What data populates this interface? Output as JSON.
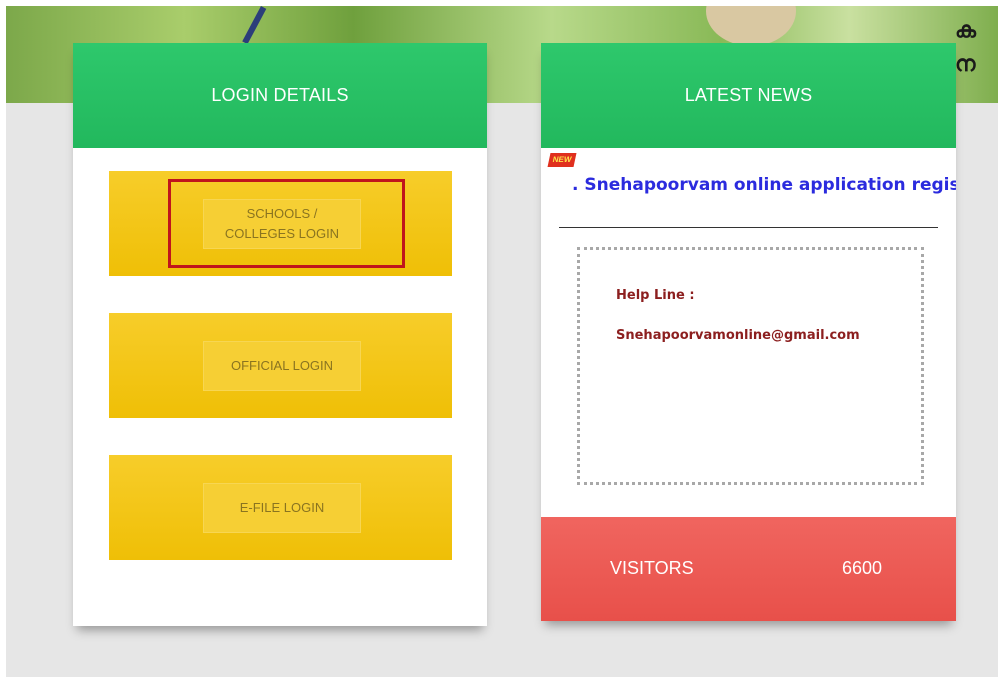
{
  "banner": {
    "title_fragment": "ക\nന"
  },
  "login": {
    "title": "LOGIN DETAILS",
    "buttons": [
      {
        "label": "SCHOOLS / COLLEGES LOGIN"
      },
      {
        "label": "OFFICIAL LOGIN"
      },
      {
        "label": "E-FILE LOGIN"
      }
    ]
  },
  "news": {
    "title": "LATEST NEWS",
    "badge": "NEW",
    "ticker": ". Snehapoorvam online application regis",
    "help_label": "Help Line :",
    "help_email": "Snehapoorvamonline@gmail.com"
  },
  "visitors": {
    "label": "VISITORS",
    "count": "6600"
  },
  "colors": {
    "header_green": "#22b85d",
    "login_yellow": "#f2c40e",
    "visitors_red": "#e8504a",
    "highlight_red": "#c0141c",
    "ticker_blue": "#2b2bde"
  }
}
